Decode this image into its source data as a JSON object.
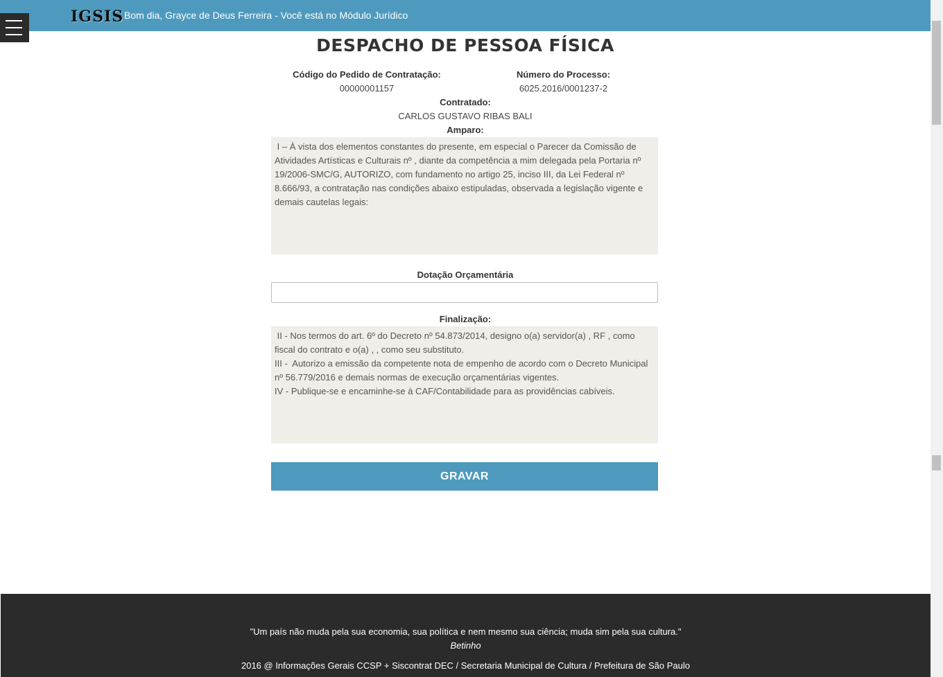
{
  "header": {
    "logo": "IGSIS",
    "greeting": "Bom dia, Grayce de Deus Ferreira - Você está no Módulo Jurídico"
  },
  "page": {
    "title": "DESPACHO DE PESSOA FÍSICA"
  },
  "pedido": {
    "codigo_label": "Código do Pedido de Contratação:",
    "codigo_value": "00000001157",
    "processo_label": "Número do Processo:",
    "processo_value": "6025.2016/0001237-2",
    "contratado_label": "Contratado:",
    "contratado_value": "CARLOS GUSTAVO RIBAS BALI"
  },
  "amparo": {
    "label": "Amparo:",
    "text": " I – À vista dos elementos constantes do presente, em especial o Parecer da Comissão de Atividades Artísticas e Culturais nº , diante da competência a mim delegada pela Portaria nº 19/2006-SMC/G, AUTORIZO, com fundamento no artigo 25, inciso III, da Lei Federal nº 8.666/93, a contratação nas condições abaixo estipuladas, observada a legislação vigente e demais cautelas legais:"
  },
  "dotacao": {
    "label": "Dotação Orçamentária",
    "value": ""
  },
  "finalizacao": {
    "label": "Finalização:",
    "text": " II - Nos termos do art. 6º do Decreto nº 54.873/2014, designo o(a) servidor(a) , RF , como fiscal do contrato e o(a) , , como seu substituto.\nIII -  Autorizo a emissão da competente nota de empenho de acordo com o Decreto Municipal nº 56.779/2016 e demais normas de execução orçamentárias vigentes.\nIV - Publique-se e encaminhe-se à CAF/Contabilidade para as providências cabíveis."
  },
  "actions": {
    "gravar": "GRAVAR"
  },
  "footer": {
    "quote": "\"Um país não muda pela sua economia, sua política e nem mesmo sua ciência; muda sim pela sua cultura.\"",
    "author": "Betinho",
    "credits": "2016 @ Informações Gerais CCSP + Siscontrat DEC / Secretaria Municipal de Cultura / Prefeitura de São Paulo"
  },
  "icons": {
    "menu": "hamburger-menu-icon"
  },
  "colors": {
    "header_bg": "#4e9abe",
    "button_bg": "#4e9abe",
    "textarea_bg": "#efeee8",
    "footer_bg": "#2b2b2b"
  }
}
